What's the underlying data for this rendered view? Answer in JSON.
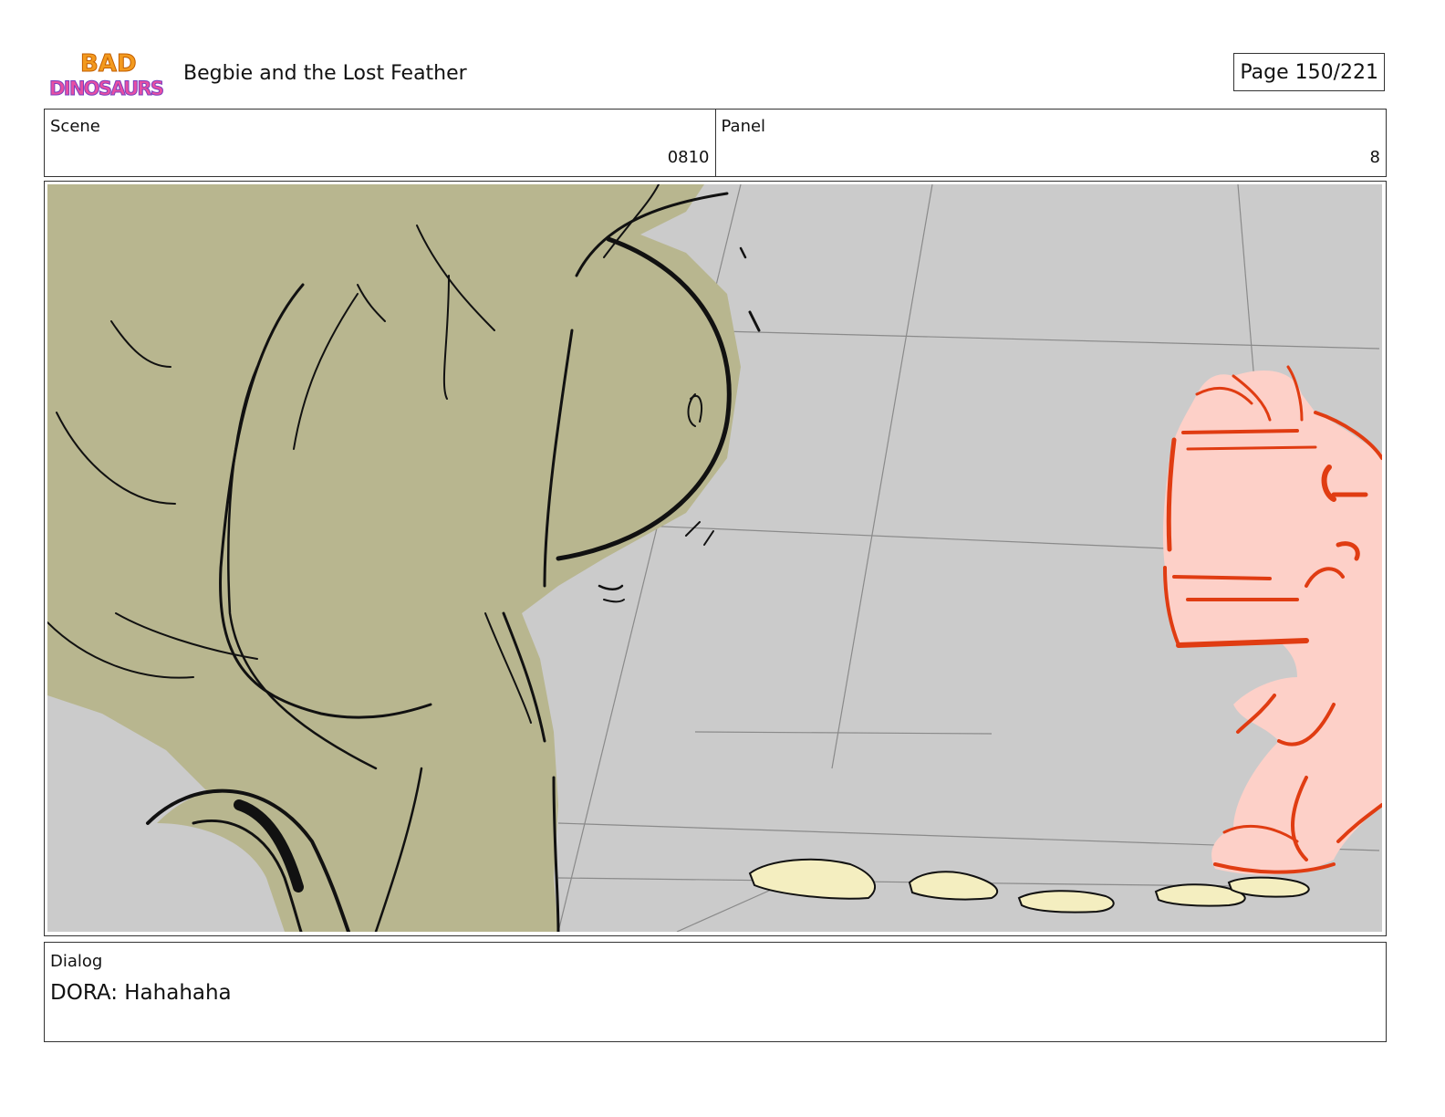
{
  "header": {
    "logo_text_top": "BAD",
    "logo_text_bottom": "DINOSAURS",
    "title": "Begbie and the Lost Feather",
    "page_label": "Page 150/221"
  },
  "info": {
    "scene_label": "Scene",
    "scene_value": "0810",
    "panel_label": "Panel",
    "panel_value": "8"
  },
  "dialog": {
    "label": "Dialog",
    "text": "DORA: Hahahaha"
  },
  "colors": {
    "background_floor": "#cbcbcb",
    "big_dino": "#b8b68f",
    "small_dino_fill": "#fdd0c8",
    "small_dino_line": "#e03c12",
    "crumbs": "#f4eec0",
    "ink": "#111111"
  }
}
